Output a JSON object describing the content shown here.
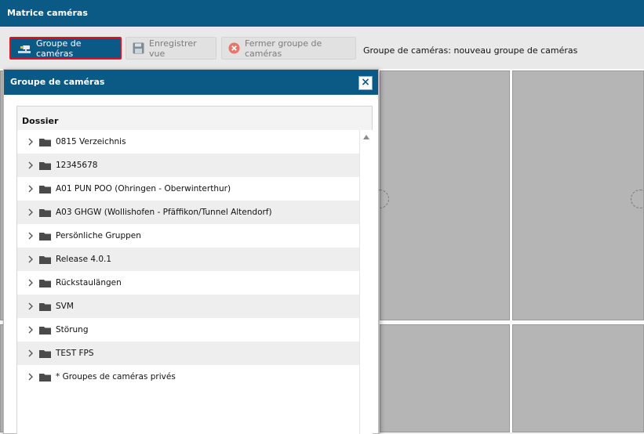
{
  "app": {
    "title": "Matrice caméras"
  },
  "toolbar": {
    "camera_group_label": "Groupe de caméras",
    "save_view_label": "Enregistrer vue",
    "close_group_label": "Fermer groupe de caméras",
    "status_text": "Groupe de caméras: nouveau groupe de caméras"
  },
  "panel": {
    "title": "Groupe de caméras",
    "close_symbol": "×",
    "column_header": "Dossier",
    "items": [
      {
        "label": "0815 Verzeichnis"
      },
      {
        "label": "12345678"
      },
      {
        "label": "A01 PUN POO (Ohringen - Oberwinterthur)"
      },
      {
        "label": "A03 GHGW (Wollishofen - Pfäffikon/Tunnel Altendorf)"
      },
      {
        "label": "Persönliche Gruppen"
      },
      {
        "label": "Release 4.0.1"
      },
      {
        "label": "Rückstaulängen"
      },
      {
        "label": "SVM"
      },
      {
        "label": "Störung"
      },
      {
        "label": "TEST FPS"
      },
      {
        "label": "* Groupes de caméras privés"
      }
    ]
  },
  "icons": {
    "camera_group": "camera-icon",
    "save": "floppy-disk-icon",
    "close_group": "red-x-circle-icon",
    "folder": "folder-icon",
    "expand": "chevron-right-icon"
  },
  "colors": {
    "header_blue": "#0b5a86",
    "highlight_red": "#e4101c",
    "grid_gray": "#b5b5b5"
  }
}
